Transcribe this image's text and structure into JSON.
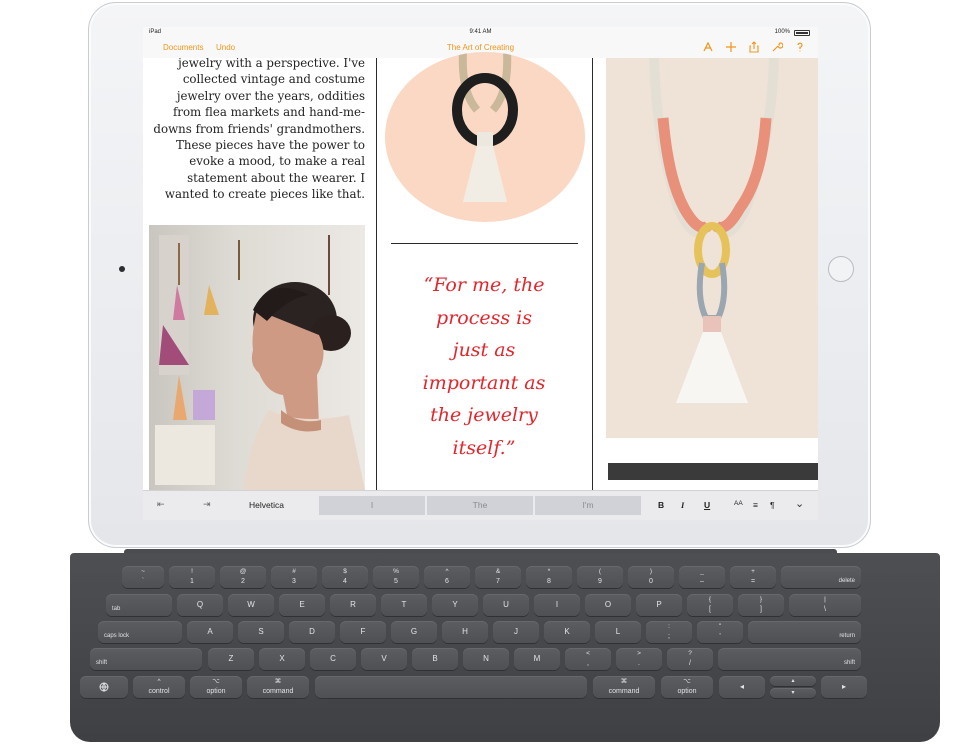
{
  "status": {
    "carrier": "iPad",
    "time": "9:41 AM",
    "battery": "100%"
  },
  "nav": {
    "documents": "Documents",
    "undo": "Undo",
    "title": "The Art of Creating",
    "icons": [
      "brush-icon",
      "plus-icon",
      "share-icon",
      "wrench-icon",
      "help-icon"
    ]
  },
  "doc": {
    "body_lines": [
      "jewelry with a perspective. I've",
      "collected vintage and costume",
      "jewelry over the years, oddities",
      "from flea markets and hand-me-",
      "downs from friends' grandmothers.",
      "These pieces have the power to",
      "evoke a mood, to make a real",
      "statement about the wearer. I",
      "wanted to create pieces like that."
    ],
    "quote_lines": [
      "“For me, the",
      "process is",
      "just as",
      "important as",
      "the jewelry",
      "itself.”"
    ],
    "colors": {
      "quote": "#e2262c",
      "accent": "#f0961c"
    }
  },
  "shortcut_bar": {
    "font": "Helvetica",
    "suggestions": [
      "I",
      "The",
      "I'm"
    ],
    "format": {
      "bold": "B",
      "italic": "I",
      "underline": "U",
      "size": "AA",
      "align": "≡",
      "para": "¶"
    }
  },
  "keyboard": {
    "row1": [
      [
        "~",
        "`"
      ],
      [
        "!",
        "1"
      ],
      [
        "@",
        "2"
      ],
      [
        "#",
        "3"
      ],
      [
        "$",
        "4"
      ],
      [
        "%",
        "5"
      ],
      [
        "^",
        "6"
      ],
      [
        "&",
        "7"
      ],
      [
        "*",
        "8"
      ],
      [
        "(",
        "9"
      ],
      [
        ")",
        "0"
      ],
      [
        "_",
        "–"
      ],
      [
        "+",
        "="
      ]
    ],
    "delete": "delete",
    "tab": "tab",
    "row2": [
      "Q",
      "W",
      "E",
      "R",
      "T",
      "Y",
      "U",
      "I",
      "O",
      "P"
    ],
    "row2_punct": [
      [
        "{",
        "["
      ],
      [
        "}",
        "]"
      ],
      [
        "|",
        "\\"
      ]
    ],
    "caps": "caps lock",
    "row3": [
      "A",
      "S",
      "D",
      "F",
      "G",
      "H",
      "J",
      "K",
      "L"
    ],
    "row3_punct": [
      [
        ":",
        ";"
      ],
      [
        "\"",
        "'"
      ]
    ],
    "return": "return",
    "shift": "shift",
    "row4": [
      "Z",
      "X",
      "C",
      "V",
      "B",
      "N",
      "M"
    ],
    "row4_punct": [
      [
        "<",
        ","
      ],
      [
        ">",
        "."
      ],
      [
        "?",
        "/"
      ]
    ],
    "control": "control",
    "option": "option",
    "command": "command",
    "command_glyph": "⌘",
    "option_glyph": "⌥",
    "control_glyph": "^"
  }
}
